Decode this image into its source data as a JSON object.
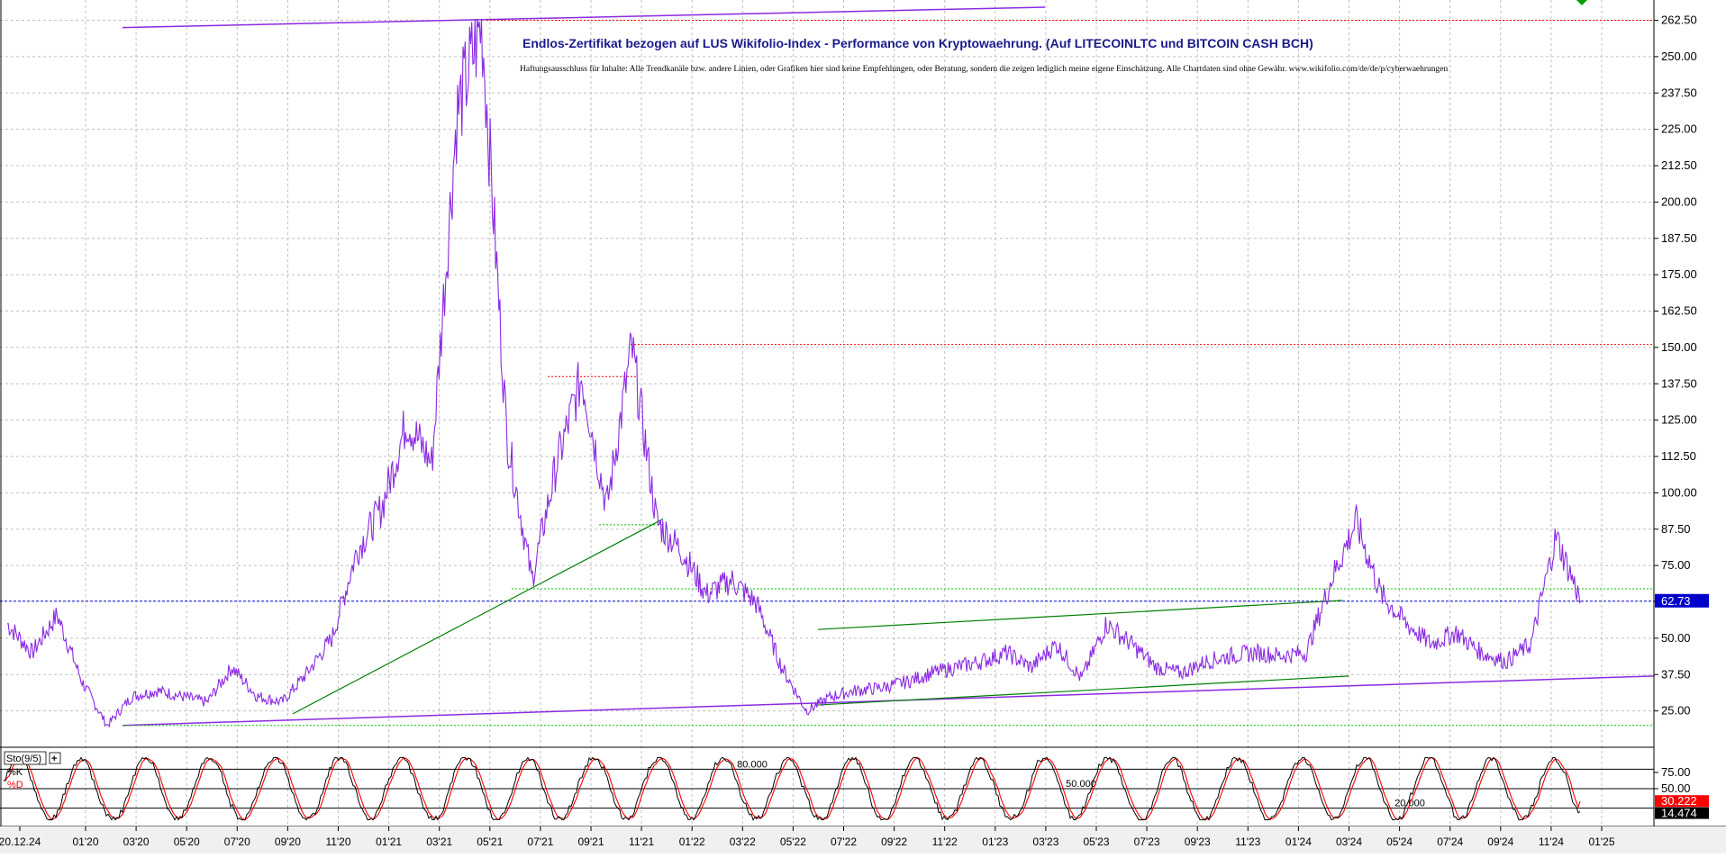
{
  "chart_data": [
    {
      "type": "line",
      "title": "Endlos-Zertifikat bezogen auf LUS Wikifolio-Index - Performance von Kryptowaehrung. (Auf LITECOINLTC und BITCOIN CASH BCH)",
      "subtitle": "Haftungsausschluss für Inhalte: Alle Trendkanäle bzw. andere Linien, oder Grafiken hier sind keine Empfehlungen, oder Beratung, sondern die zeigen lediglich meine eigene Einschätzung. Alle Chartdaten sind ohne Gewähr. www.wikifolio.com/de/de/p/cyberwaehrungen",
      "ylim": [
        12.5,
        267
      ],
      "y_ticks": [
        "262.50",
        "250.00",
        "237.50",
        "225.00",
        "212.50",
        "200.00",
        "187.50",
        "175.00",
        "162.50",
        "150.00",
        "137.50",
        "125.00",
        "112.50",
        "100.00",
        "87.50",
        "75.00",
        "62.73",
        "50.00",
        "37.50",
        "25.00"
      ],
      "y_tick_values": [
        262.5,
        250,
        237.5,
        225,
        212.5,
        200,
        187.5,
        175,
        162.5,
        150,
        137.5,
        125,
        112.5,
        100,
        87.5,
        75,
        62.73,
        50,
        37.5,
        25
      ],
      "last_value_label": "62.73",
      "last_value": 62.73,
      "x_ticks": [
        "20.12.24",
        "01'20",
        "03'20",
        "05'20",
        "07'20",
        "09'20",
        "11'20",
        "01'21",
        "03'21",
        "05'21",
        "07'21",
        "09'21",
        "11'21",
        "01'22",
        "03'22",
        "05'22",
        "07'22",
        "09'22",
        "11'22",
        "01'23",
        "03'23",
        "05'23",
        "07'23",
        "09'23",
        "11'23",
        "01'24",
        "03'24",
        "05'24",
        "07'24",
        "09'24",
        "11'24",
        "01'25"
      ],
      "grid": true,
      "colors": {
        "price": "#8a2be2",
        "trend_green": "#008000",
        "resistance_red": "#ff0000",
        "last_value_blue": "#0000cc",
        "support_green": "#00c000",
        "channel_purple": "#8a2be2"
      },
      "series": [
        {
          "x": [
            "2019-12",
            "2020-01",
            "2020-02",
            "2020-03",
            "2020-03",
            "2020-04",
            "2020-05",
            "2020-06",
            "2020-07",
            "2020-08",
            "2020-09",
            "2020-10",
            "2020-11",
            "2020-12",
            "2021-01",
            "2021-02",
            "2021-03",
            "2021-04",
            "2021-05",
            "2021-05",
            "2021-06",
            "2021-07",
            "2021-08",
            "2021-09",
            "2021-10",
            "2021-11",
            "2021-12",
            "2022-01",
            "2022-02",
            "2022-03",
            "2022-04",
            "2022-05",
            "2022-06",
            "2022-07",
            "2022-08",
            "2022-09",
            "2022-10",
            "2022-11",
            "2022-12",
            "2023-01",
            "2023-02",
            "2023-03",
            "2023-04",
            "2023-05",
            "2023-06",
            "2023-07",
            "2023-08",
            "2023-09",
            "2023-10",
            "2023-11",
            "2023-12",
            "2024-01",
            "2024-02",
            "2024-03",
            "2024-04",
            "2024-05",
            "2024-06",
            "2024-07",
            "2024-08",
            "2024-09",
            "2024-10",
            "2024-11",
            "2024-12",
            "2024-12"
          ],
          "values": [
            55,
            45,
            58,
            35,
            20,
            30,
            32,
            30,
            28,
            40,
            30,
            28,
            38,
            50,
            80,
            95,
            125,
            110,
            230,
            262,
            120,
            70,
            110,
            140,
            95,
            150,
            90,
            80,
            65,
            70,
            62,
            40,
            25,
            30,
            32,
            33,
            35,
            38,
            40,
            42,
            45,
            40,
            48,
            36,
            55,
            48,
            40,
            38,
            42,
            44,
            45,
            44,
            45,
            70,
            90,
            65,
            55,
            48,
            52,
            45,
            42,
            48,
            85,
            62.73
          ]
        }
      ],
      "annotations": {
        "resistance_lines": [
          262.5,
          151,
          140
        ],
        "support_lines": [
          89,
          67,
          20
        ]
      }
    },
    {
      "type": "line",
      "title": "Sto(9/5)",
      "series_labels": [
        "%K",
        "%D"
      ],
      "ylim": [
        0,
        100
      ],
      "y_ticks": [
        "75.00",
        "50.00"
      ],
      "y_tick_values": [
        75,
        50
      ],
      "levels": [
        {
          "value": 80,
          "label": "80.000"
        },
        {
          "value": 50,
          "label": "50.000"
        },
        {
          "value": 20,
          "label": "20.000"
        }
      ],
      "last_labels": [
        "30.222",
        "14.474"
      ],
      "last_values": [
        30.222,
        14.474
      ],
      "colors": {
        "k": "#000000",
        "d": "#ff0000",
        "last_d_bg": "#ff0000",
        "last_k_bg": "#000000"
      }
    }
  ]
}
